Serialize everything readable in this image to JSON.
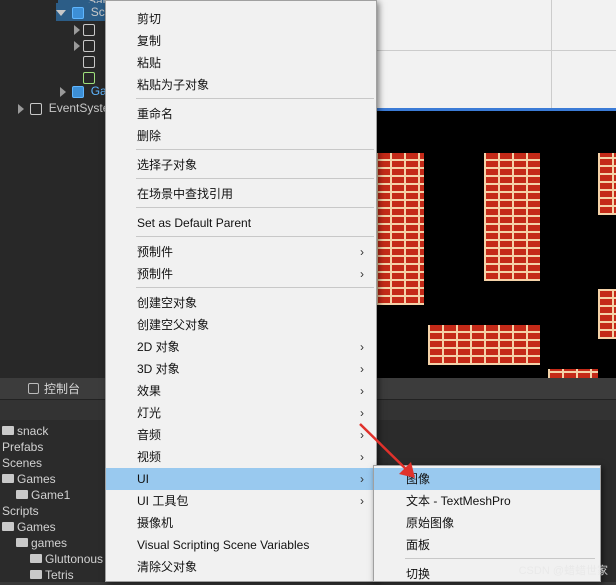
{
  "hierarchy": {
    "rows": [
      {
        "label": "SampleScene"
      },
      {
        "label": "Scene"
      },
      {
        "label": ""
      },
      {
        "label": ""
      },
      {
        "label": ""
      },
      {
        "label": ""
      },
      {
        "label": "Game"
      },
      {
        "label": "EventSystem"
      }
    ]
  },
  "console_tab": {
    "label": "控制台"
  },
  "project": {
    "rows": [
      "snack",
      "Prefabs",
      "Scenes",
      "Games",
      "Game1",
      "Scripts",
      "Games",
      "games",
      "Gluttonous",
      "Tetris"
    ]
  },
  "context_menu": {
    "items": [
      {
        "label": "剪切"
      },
      {
        "label": "复制"
      },
      {
        "label": "粘贴"
      },
      {
        "label": "粘贴为子对象"
      },
      {
        "label": "重命名"
      },
      {
        "label": "删除"
      },
      {
        "label": "选择子对象"
      },
      {
        "label": "在场景中查找引用"
      },
      {
        "label": "Set as Default Parent"
      },
      {
        "label": "预制件"
      },
      {
        "label": "预制件"
      },
      {
        "label": "创建空对象"
      },
      {
        "label": "创建空父对象"
      },
      {
        "label": "2D 对象"
      },
      {
        "label": "3D 对象"
      },
      {
        "label": "效果"
      },
      {
        "label": "灯光"
      },
      {
        "label": "音频"
      },
      {
        "label": "视频"
      },
      {
        "label": "UI"
      },
      {
        "label": "UI 工具包"
      },
      {
        "label": "摄像机"
      },
      {
        "label": "Visual Scripting Scene Variables"
      },
      {
        "label": "清除父对象"
      }
    ],
    "arrow_glyph": "›"
  },
  "ui_submenu": {
    "items": [
      {
        "label": "图像"
      },
      {
        "label": "文本 - TextMeshPro"
      },
      {
        "label": "原始图像"
      },
      {
        "label": "面板"
      },
      {
        "label": "切换"
      }
    ]
  },
  "watermark": "CSDN @蜡蜡世家",
  "colors": {
    "menu_highlight": "#99c9ef",
    "selection": "#2c5d87",
    "annotation_arrow": "#e0312b"
  }
}
